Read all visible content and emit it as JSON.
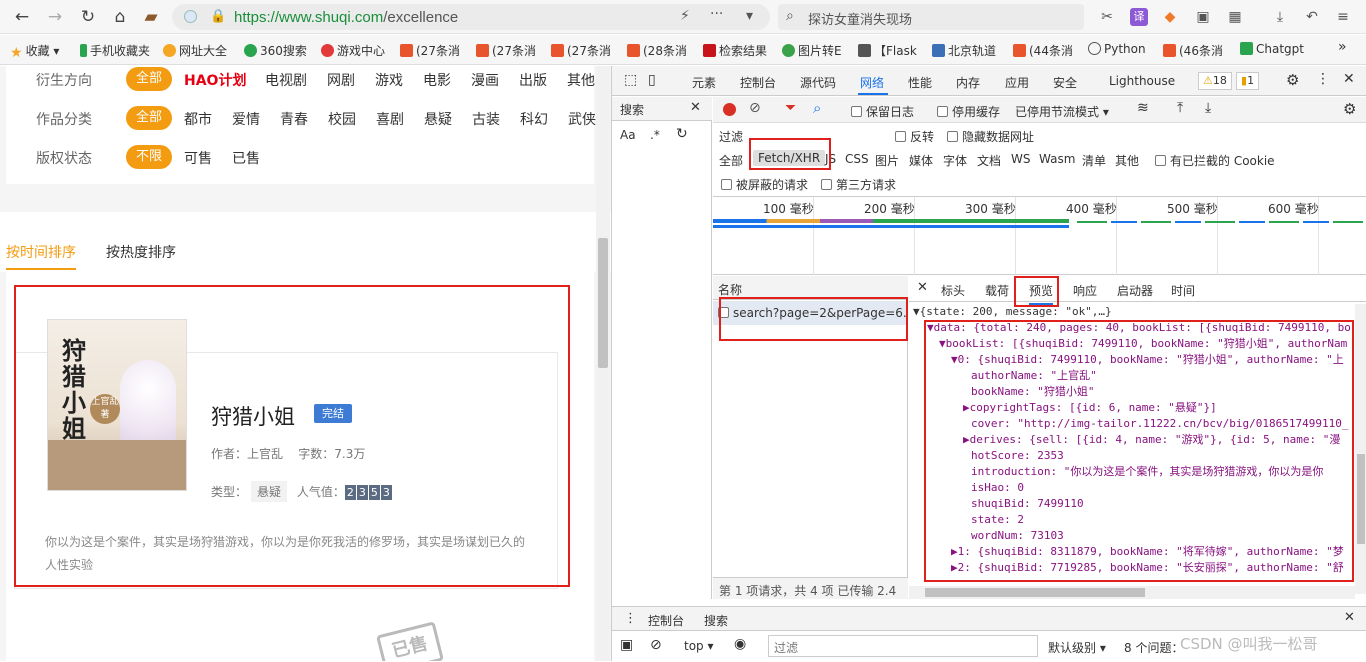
{
  "browser": {
    "url_prefix": "https://",
    "url_domain": "www.shuqi.com",
    "url_path": "/excellence",
    "search_text": "探访女童消失现场",
    "nav_icons": [
      "back-icon",
      "forward-icon",
      "reload-icon",
      "home-icon",
      "wallet-icon"
    ]
  },
  "bookmarks": [
    {
      "label": "收藏",
      "color": "#f5a623"
    },
    {
      "label": "手机收藏夹",
      "color": "#2aa44f"
    },
    {
      "label": "网址大全",
      "color": "#f5a623"
    },
    {
      "label": "360搜索",
      "color": "#2aa44f"
    },
    {
      "label": "游戏中心",
      "color": "#e23a3a"
    },
    {
      "label": "(27条消",
      "color": "#e8542c"
    },
    {
      "label": "(27条消",
      "color": "#e8542c"
    },
    {
      "label": "(27条消",
      "color": "#e8542c"
    },
    {
      "label": "(28条消",
      "color": "#e8542c"
    },
    {
      "label": "检索结果",
      "color": "#c7131a"
    },
    {
      "label": "图片转E",
      "color": "#3aa34a"
    },
    {
      "label": "【Flask",
      "color": "#555555"
    },
    {
      "label": "北京轨道",
      "color": "#3b6fb6"
    },
    {
      "label": "(44条消",
      "color": "#e8542c"
    },
    {
      "label": "Python",
      "color": "#555555"
    },
    {
      "label": "(46条消",
      "color": "#e8542c"
    },
    {
      "label": "Chatgpt",
      "color": "#2aa44f"
    }
  ],
  "filters": {
    "row1_label": "衍生方向",
    "row1_selected": "全部",
    "row1_items": [
      "HAO计划",
      "电视剧",
      "网剧",
      "游戏",
      "电影",
      "漫画",
      "出版",
      "其他"
    ],
    "row2_label": "作品分类",
    "row2_selected": "全部",
    "row2_items": [
      "都市",
      "爱情",
      "青春",
      "校园",
      "喜剧",
      "悬疑",
      "古装",
      "科幻",
      "武侠"
    ],
    "row3_label": "版权状态",
    "row3_selected": "不限",
    "row3_items": [
      "可售",
      "已售"
    ]
  },
  "sort": {
    "by_time": "按时间排序",
    "by_hot": "按热度排序"
  },
  "book": {
    "cover_title": "狩猎小姐",
    "cover_author": "上官乱著",
    "title": "狩猎小姐",
    "status": "完结",
    "author_label": "作者：上官乱",
    "wordcount_label": "字数：7.3万",
    "type_label": "类型：",
    "type_value": "悬疑",
    "popularity_label": "人气值：",
    "popularity_digits": [
      "2",
      "3",
      "5",
      "3"
    ],
    "intro": "你以为这是个案件，其实是场狩猎游戏，你以为是你死我活的修罗场，其实是场谋划已久的人性实验",
    "stamp": "已售"
  },
  "devtools": {
    "tabs": [
      "元素",
      "控制台",
      "源代码",
      "网络",
      "性能",
      "内存",
      "应用",
      "安全",
      "Lighthouse"
    ],
    "warnings": "18",
    "info": "1",
    "search_tab": "搜索",
    "net_options": {
      "preserve_log": "保留日志",
      "disable_cache": "停用缓存",
      "throttle": "已停用节流模式"
    },
    "filter_label": "过滤",
    "invert": "反转",
    "hide_data_urls": "隐藏数据网址",
    "types": [
      "全部",
      "Fetch/XHR",
      "JS",
      "CSS",
      "图片",
      "媒体",
      "字体",
      "文档",
      "WS",
      "Wasm",
      "清单",
      "其他"
    ],
    "blocked_cookies": "有已拦截的 Cookie",
    "blocked_requests": "被屏蔽的请求",
    "third_party": "第三方请求",
    "timeline_labels": [
      "100 毫秒",
      "200 毫秒",
      "300 毫秒",
      "400 毫秒",
      "500 毫秒",
      "600 毫秒"
    ],
    "name_header": "名称",
    "request_name": "search?page=2&perPage=6...",
    "request_status": "第 1 项请求，共 4 项   已传输 2.4",
    "detail_tabs": [
      "标头",
      "载荷",
      "预览",
      "响应",
      "启动器",
      "时间"
    ],
    "preview_lines": [
      "▼{state: 200, message: \"ok\",…}",
      "▼data: {total: 240, pages: 40, bookList: [{shuqiBid: 7499110, bo",
      "▼bookList: [{shuqiBid: 7499110, bookName: \"狩猎小姐\", authorNam",
      "▼0: {shuqiBid: 7499110, bookName: \"狩猎小姐\", authorName: \"上",
      "authorName: \"上官乱\"",
      "bookName: \"狩猎小姐\"",
      "▶copyrightTags: [{id: 6, name: \"悬疑\"}]",
      "cover: \"http://img-tailor.11222.cn/bcv/big/0186517499110_",
      "▶derives: {sell: [{id: 4, name: \"游戏\"}, {id: 5, name: \"漫",
      "hotScore: 2353",
      "introduction: \"你以为这是个案件，其实是场狩猎游戏，你以为是你",
      "isHao: 0",
      "shuqiBid: 7499110",
      "state: 2",
      "wordNum: 73103",
      "▶1: {shuqiBid: 8311879, bookName: \"将军待嫁\", authorName: \"梦",
      "▶2: {shuqiBid: 7719285, bookName: \"长安丽探\", authorName: \"舒"
    ],
    "drawer_tabs": [
      "控制台",
      "搜索"
    ],
    "context": "top",
    "console_filter_placeholder": "过滤",
    "log_level": "默认级别",
    "issues": "8 个问题：",
    "watermark": "CSDN @叫我一松哥"
  },
  "colors": {
    "accent": "#f39c12",
    "highlight": "#e0211b",
    "link": "#1a73e8"
  }
}
